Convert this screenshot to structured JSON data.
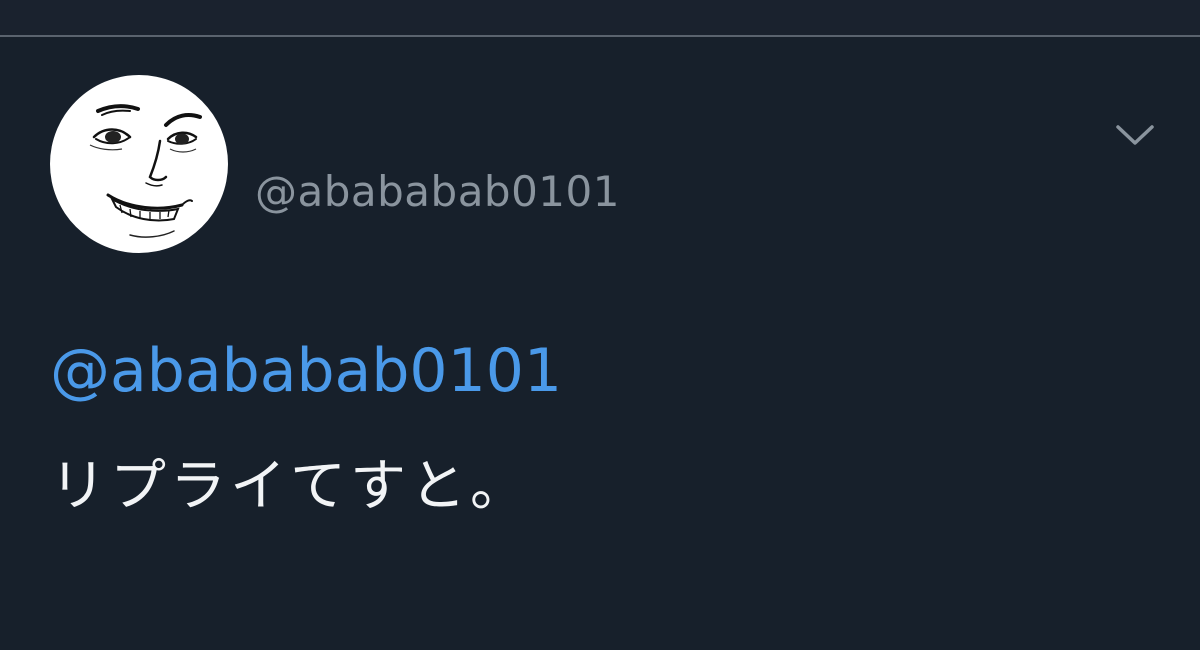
{
  "tweet": {
    "handle": "@abababab0101",
    "avatar_icon": "smug-face-avatar-icon",
    "menu_icon": "chevron-down-icon",
    "mention": "@abababab0101",
    "text": "リプライてすと。"
  },
  "colors": {
    "background": "#17202b",
    "divider": "#5a636e",
    "handle": "#8a949e",
    "mention": "#4a99e9",
    "text": "#f2f4f6",
    "caret": "#8a949e"
  }
}
